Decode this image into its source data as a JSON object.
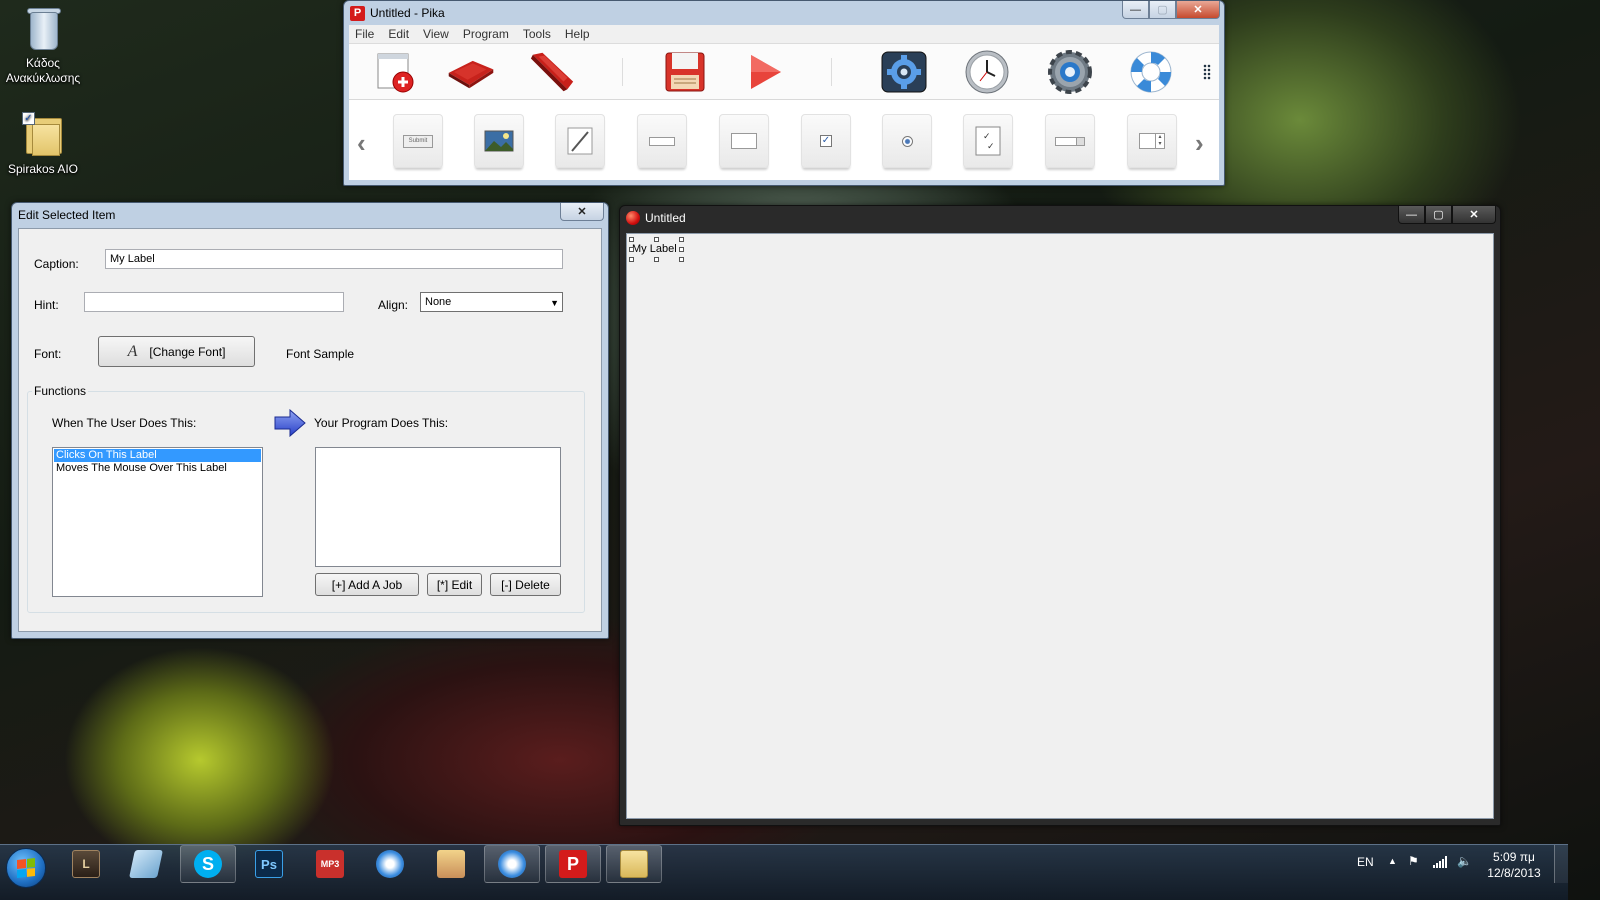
{
  "desktop": {
    "icons": [
      {
        "label": "Κάδος Ανακύκλωσης",
        "icon": "recycle-bin-icon"
      },
      {
        "label": "Spirakos AIO",
        "icon": "folder-icon"
      }
    ]
  },
  "pika": {
    "title": "Untitled - Pika",
    "menu": [
      "File",
      "Edit",
      "View",
      "Program",
      "Tools",
      "Help"
    ],
    "toolbar_main": [
      "new-form-icon",
      "open-icon",
      "cut-icon",
      "save-icon",
      "run-icon",
      "settings-icon",
      "clock-icon",
      "gear-icon",
      "help-icon"
    ],
    "toolbar_controls": [
      "button-control-icon",
      "image-control-icon",
      "pen-control-icon",
      "edit-control-icon",
      "label-control-icon",
      "checkbox-control-icon",
      "radio-control-icon",
      "checklist-control-icon",
      "combobox-control-icon",
      "spinner-control-icon"
    ],
    "submit_glyph": "Submit"
  },
  "edit_window": {
    "title": "Edit Selected Item",
    "caption_label": "Caption:",
    "caption_value": "My Label",
    "hint_label": "Hint:",
    "hint_value": "",
    "align_label": "Align:",
    "align_value": "None",
    "font_label": "Font:",
    "change_font_button": "[Change Font]",
    "font_glyph": "A",
    "font_sample": "Font Sample",
    "functions_label": "Functions",
    "user_does_label": "When The User Does This:",
    "program_does_label": "Your Program Does This:",
    "events": [
      "Clicks On This Label",
      "Moves The Mouse Over This Label"
    ],
    "selected_event_index": 0,
    "jobs": [],
    "add_job_button": "[+]  Add  A Job",
    "edit_button": "[*]  Edit",
    "delete_button": "[-]  Delete"
  },
  "form_window": {
    "title": "Untitled",
    "label_text": "My Label"
  },
  "taskbar": {
    "apps": [
      {
        "name": "lineage-icon",
        "glyph": "L"
      },
      {
        "name": "notepad-icon",
        "glyph": ""
      },
      {
        "name": "skype-icon",
        "glyph": "S"
      },
      {
        "name": "photoshop-icon",
        "glyph": "Ps"
      },
      {
        "name": "mp3-icon",
        "glyph": "MP3"
      },
      {
        "name": "safari-icon",
        "glyph": ""
      },
      {
        "name": "anime-icon",
        "glyph": ""
      },
      {
        "name": "safari-2-icon",
        "glyph": ""
      },
      {
        "name": "pika-icon",
        "glyph": "P"
      },
      {
        "name": "explorer-icon",
        "glyph": ""
      }
    ],
    "language": "EN",
    "time": "5:09 πμ",
    "date": "12/8/2013"
  },
  "colors": {
    "accent": "#3399ff",
    "pika_red": "#d41b1b",
    "taskbar": "#1c2a3a"
  }
}
